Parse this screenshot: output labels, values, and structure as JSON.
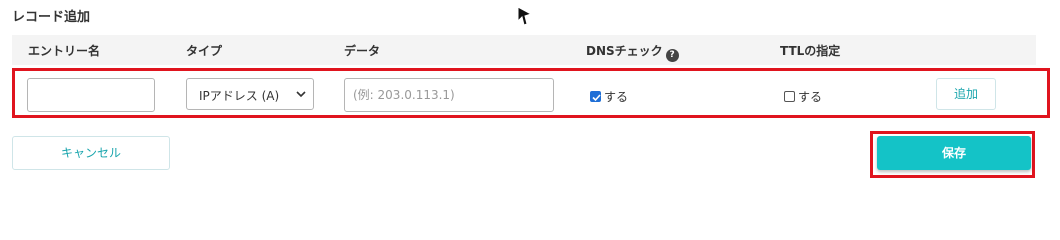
{
  "section": {
    "title": "レコード追加"
  },
  "table": {
    "headers": {
      "entry_name": "エントリー名",
      "type": "タイプ",
      "data": "データ",
      "dns_check": "DNSチェック",
      "ttl": "TTLの指定"
    }
  },
  "entry": {
    "name_value": "",
    "type_selected": "IPアドレス (A)",
    "data_value": "",
    "data_placeholder": "(例: 203.0.113.1)",
    "dns_check_label": "する",
    "dns_check_checked": true,
    "ttl_label": "する",
    "ttl_checked": false,
    "add_label": "追加"
  },
  "actions": {
    "cancel_label": "キャンセル",
    "save_label": "保存"
  },
  "colors": {
    "accent": "#14c3c7",
    "accent_text": "#1aa5ad",
    "highlight": "#e0141e",
    "checkbox": "#1f6fd6"
  },
  "icons": {
    "help": "question-circle-icon",
    "select": "chevron-down-icon",
    "cursor": "mouse-pointer-icon"
  }
}
